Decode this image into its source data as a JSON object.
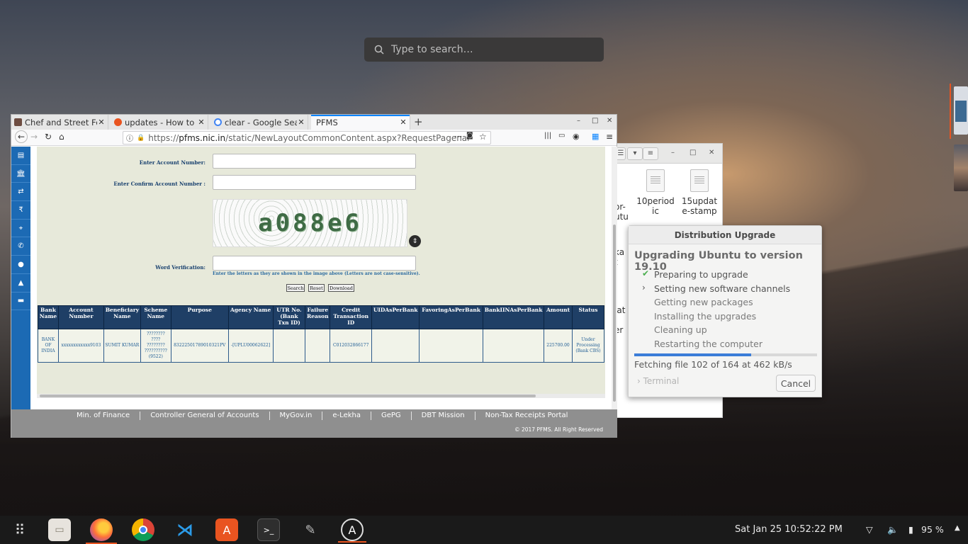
{
  "search": {
    "placeholder": "Type to search…"
  },
  "browser": {
    "tabs": [
      {
        "label": "Chef and Street Fo",
        "favicon_color": "#6d4c41"
      },
      {
        "label": "updates - How to se",
        "favicon_color": "#e95420"
      },
      {
        "label": "clear - Google Sear",
        "favicon_color": "#4285f4"
      },
      {
        "label": "PFMS",
        "favicon_color": ""
      }
    ],
    "url_prefix": "https://",
    "url_host": "pfms.nic.in",
    "url_path": "/static/NewLayoutCommonContent.aspx?RequestPagenar"
  },
  "form": {
    "account_label": "Enter Account Number:",
    "confirm_label": "Enter Confirm Account Number :",
    "captcha_text": "a088e6",
    "word_label": "Word Verification:",
    "hint": "Enter the letters as they are shown in the image above (Letters are not case-sensitive).",
    "buttons": {
      "search": "Search",
      "reset": "Reset",
      "download": "Download"
    }
  },
  "table": {
    "headers": [
      "Bank Name",
      "Account Number",
      "Beneficiary Name",
      "Scheme Name",
      "Purpose",
      "Agency Name",
      "UTR No.(Bank Txn ID)",
      "Failure Reason",
      "Credit Transaction ID",
      "UIDAsPerBank",
      "FavoringAsPerBank",
      "BankIINAsPerBank",
      "Amount",
      "Status"
    ],
    "rows": [
      [
        "BANK OF INDIA",
        "xxxxxxxxxxxx9103",
        "SUMIT KUMAR",
        "???????? ???? ???????? ?????????? (9522)",
        "83222501789010321PV",
        "-[UPLU00062622]",
        "",
        "",
        "C012032866177",
        "",
        "",
        "",
        "225700.00",
        "Under Processing (Bank CBS)"
      ]
    ]
  },
  "footer": {
    "links": [
      "Min. of Finance",
      "Controller General of Accounts",
      "MyGov.in",
      "e-Lekha",
      "GePG",
      "DBT Mission",
      "Non-Tax Receipts Portal"
    ],
    "copyright": "© 2017 PFMS. All Right Reserved"
  },
  "files_window": {
    "items": [
      "10period ic",
      "15updat e-stamp"
    ],
    "fragments": [
      "or-",
      "utu",
      "ka",
      "t",
      "lat",
      "er"
    ]
  },
  "upgrade": {
    "title": "Distribution Upgrade",
    "heading": "Upgrading Ubuntu to version 19.10",
    "steps": [
      {
        "label": "Preparing to upgrade",
        "state": "done"
      },
      {
        "label": "Setting new software channels",
        "state": "active"
      },
      {
        "label": "Getting new packages",
        "state": "pending"
      },
      {
        "label": "Installing the upgrades",
        "state": "pending"
      },
      {
        "label": "Cleaning up",
        "state": "pending"
      },
      {
        "label": "Restarting the computer",
        "state": "pending"
      }
    ],
    "progress_fraction": 0.64,
    "status": "Fetching file 102 of 164 at 462 kB/s",
    "terminal_label": "Terminal",
    "cancel_label": "Cancel"
  },
  "dock": {
    "apps": [
      "app-grid-icon",
      "files-icon",
      "firefox-icon",
      "chrome-icon",
      "vscode-icon",
      "software-center-icon",
      "terminal-icon",
      "gimp-icon",
      "software-updater-icon"
    ]
  },
  "panel": {
    "clock": "Sat Jan 25  10:52:22 PM",
    "battery": "95 %"
  }
}
